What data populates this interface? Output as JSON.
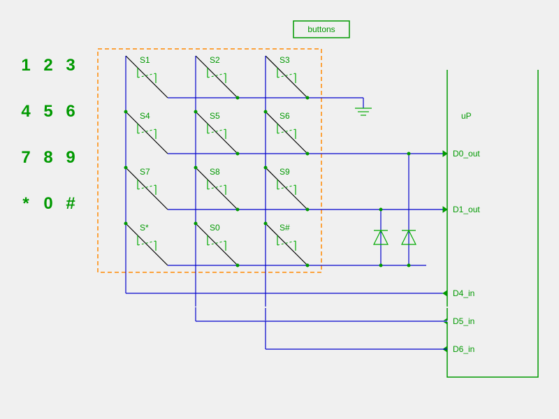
{
  "keypad": {
    "rows": [
      [
        "1",
        "2",
        "3"
      ],
      [
        "4",
        "5",
        "6"
      ],
      [
        "7",
        "8",
        "9"
      ],
      [
        "*",
        "0",
        "#"
      ]
    ]
  },
  "buttons_box_label": "buttons",
  "switches": {
    "r0": [
      "S1",
      "S2",
      "S3"
    ],
    "r1": [
      "S4",
      "S5",
      "S6"
    ],
    "r2": [
      "S7",
      "S8",
      "S9"
    ],
    "r3": [
      "S*",
      "S0",
      "S#"
    ]
  },
  "pins": {
    "up": "uP",
    "d0out": "D0_out",
    "d1out": "D1_out",
    "d4in": "D4_in",
    "d5in": "D5_in",
    "d6in": "D6_in"
  },
  "colors": {
    "wire": "#0000cc",
    "sym": "#00aa00",
    "dashbox": "#ff8800",
    "text": "#009900",
    "bg": "#f0f0f0"
  }
}
